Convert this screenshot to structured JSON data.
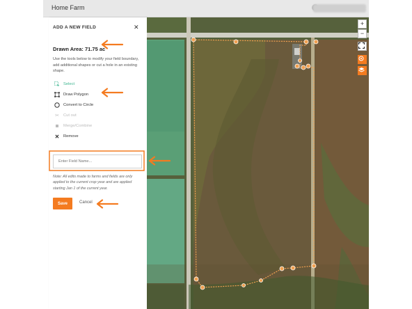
{
  "app": {
    "title": "Home Farm"
  },
  "panel": {
    "title": "ADD A NEW FIELD",
    "close_icon": "close-icon",
    "drawn_area": "Drawn Area: 71.75 ac",
    "description": "Use the tools below to modify your field boundary, add additional shapes or cut a hole in an existing shape.",
    "tools": [
      {
        "label": "Select",
        "icon": "select-icon",
        "state": "active"
      },
      {
        "label": "Draw Polygon",
        "icon": "polygon-icon",
        "state": "normal"
      },
      {
        "label": "Convert to Circle",
        "icon": "circle-icon",
        "state": "normal"
      },
      {
        "label": "Cut out",
        "icon": "scissors-icon",
        "state": "disabled"
      },
      {
        "label": "Merge/Combine",
        "icon": "merge-icon",
        "state": "disabled"
      },
      {
        "label": "Remove",
        "icon": "x-icon",
        "state": "normal"
      }
    ],
    "field_name_placeholder": "Enter Field Name...",
    "note": "Note: All edits made to farms and fields are only applied to the current crop year and are applied starting Jan 1 of the current year.",
    "save_label": "Save",
    "cancel_label": "Cancel"
  },
  "map_controls": {
    "zoom_in": "+",
    "zoom_out": "−",
    "icons": [
      "fullscreen-icon",
      "location-icon",
      "layers-icon"
    ]
  },
  "colors": {
    "accent": "#f47b20",
    "active_tool": "#3cb58f",
    "boundary": "#f0a050"
  }
}
